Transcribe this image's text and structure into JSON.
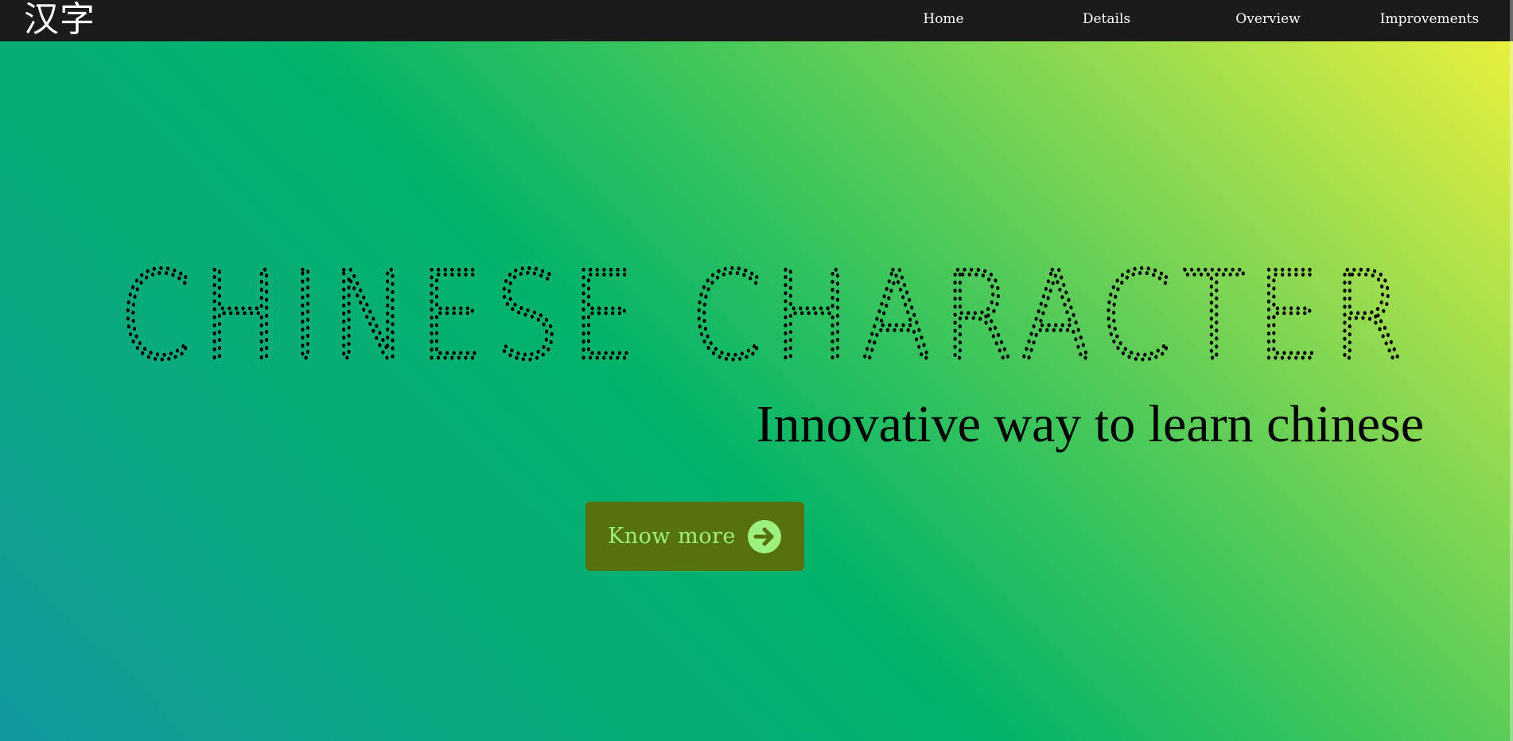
{
  "header": {
    "logo": "汉字",
    "nav": [
      {
        "label": "Home"
      },
      {
        "label": "Details"
      },
      {
        "label": "Overview"
      },
      {
        "label": "Improvements"
      }
    ]
  },
  "hero": {
    "title": "CHINESE CHARACTER",
    "subtitle": "Innovative way to learn chinese",
    "cta": {
      "label": "Know more",
      "icon": "arrow-right-circle-icon"
    }
  },
  "colors": {
    "navbar_bg": "#1b1b1b",
    "nav_text": "#ffffff",
    "gradient": [
      "#1199a0",
      "#02b36a",
      "#e8f03e"
    ],
    "button_bg": "#55720e",
    "button_text": "#9ef07e",
    "title_dots": "#000000"
  }
}
